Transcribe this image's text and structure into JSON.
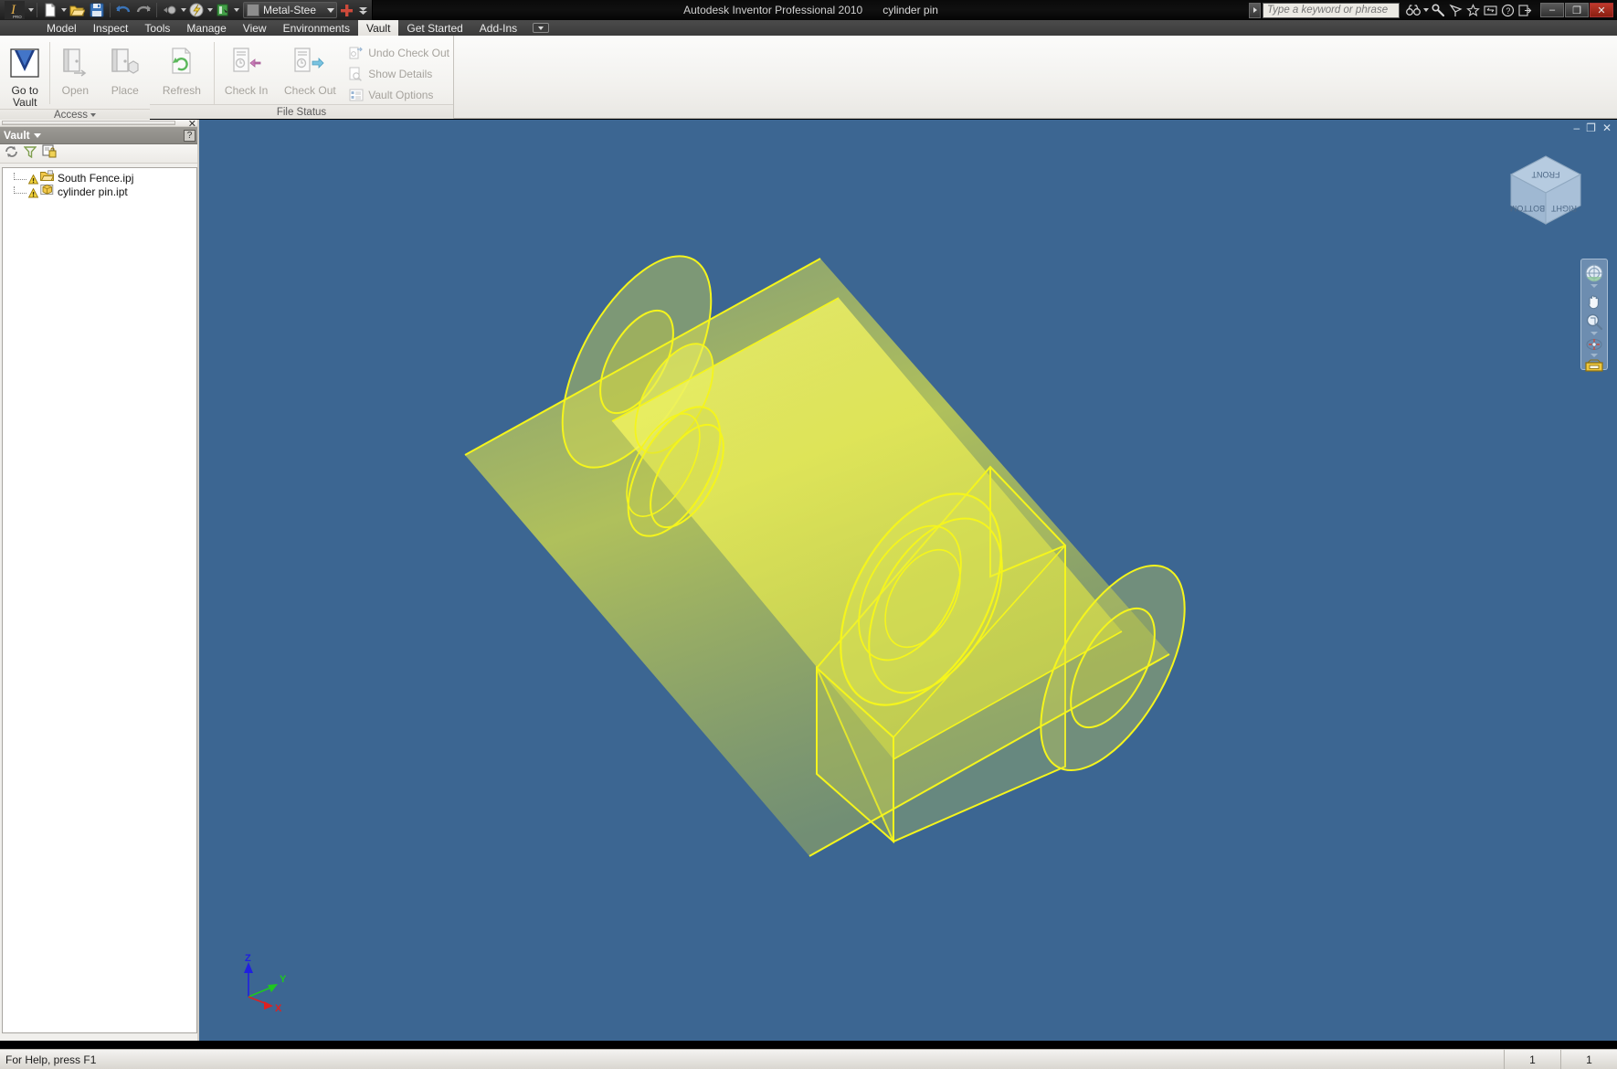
{
  "app": {
    "title": "Autodesk Inventor Professional 2010",
    "document_name": "cylinder pin"
  },
  "quick_access": {
    "new_label": "new-file",
    "open_label": "open-file",
    "save_label": "save-file",
    "undo_label": "undo",
    "redo_label": "redo",
    "material_value": "Metal-Stee",
    "plus_label": "+",
    "dropdown_label": "customize"
  },
  "search": {
    "placeholder": "Type a keyword or phrase",
    "icons": [
      "binoculars-icon",
      "wrench-icon",
      "satellite-icon",
      "star-icon",
      "exchange-icon",
      "help-icon",
      "signout-icon"
    ]
  },
  "window_controls": {
    "minimize": "–",
    "restore": "❐",
    "close": "✕"
  },
  "ribbon": {
    "tabs": [
      {
        "label": "Model",
        "active": false
      },
      {
        "label": "Inspect",
        "active": false
      },
      {
        "label": "Tools",
        "active": false
      },
      {
        "label": "Manage",
        "active": false
      },
      {
        "label": "View",
        "active": false
      },
      {
        "label": "Environments",
        "active": false
      },
      {
        "label": "Vault",
        "active": true
      },
      {
        "label": "Get Started",
        "active": false
      },
      {
        "label": "Add-Ins",
        "active": false
      }
    ],
    "panels": [
      {
        "title": "Access",
        "has_dropdown": true,
        "big_buttons": [
          {
            "label": "Go to Vault",
            "icon": "vault-icon",
            "disabled": false
          },
          {
            "label": "Open",
            "icon": "open-door-icon",
            "disabled": true
          },
          {
            "label": "Place",
            "icon": "place-door-icon",
            "disabled": true
          }
        ]
      },
      {
        "title": "File Status",
        "has_dropdown": false,
        "big_buttons": [
          {
            "label": "Refresh",
            "icon": "refresh-icon",
            "disabled": true
          },
          {
            "label": "Check In",
            "icon": "check-in-icon",
            "disabled": true
          },
          {
            "label": "Check Out",
            "icon": "check-out-icon",
            "disabled": true
          }
        ],
        "small_buttons": [
          {
            "label": "Undo Check Out",
            "icon": "undo-check-out-icon",
            "disabled": true
          },
          {
            "label": "Show Details",
            "icon": "show-details-icon",
            "disabled": true
          },
          {
            "label": "Vault Options",
            "icon": "vault-options-icon",
            "disabled": true
          }
        ]
      }
    ]
  },
  "browser": {
    "title": "Vault",
    "help_glyph": "?",
    "toolbar": [
      {
        "name": "refresh-icon",
        "tooltip": "Refresh"
      },
      {
        "name": "filter-icon",
        "tooltip": "Filter"
      },
      {
        "name": "add-lock-icon",
        "tooltip": "Check In"
      }
    ],
    "tree": [
      {
        "label": "South Fence.ipj",
        "icon": "project-folder-icon",
        "status": "warning-icon"
      },
      {
        "label": "cylinder pin.ipt",
        "icon": "part-file-icon",
        "status": "warning-icon"
      }
    ]
  },
  "viewport": {
    "background_color": "#3c6692",
    "model_color": "#f2f215",
    "model_name": "cylinder pin",
    "viewcube": {
      "faces": [
        "FRONT",
        "BOTTOM",
        "RIGHT"
      ]
    },
    "navigation_bar": [
      {
        "name": "steering-wheel-icon"
      },
      {
        "name": "pan-hand-icon"
      },
      {
        "name": "zoom-magnifier-icon"
      },
      {
        "name": "orbit-icon"
      },
      {
        "name": "look-at-icon"
      }
    ],
    "axis_indicator": {
      "x_label": "X",
      "x_color": "#e02020",
      "y_label": "Y",
      "y_color": "#1ec81e",
      "z_label": "Z",
      "z_color": "#2020e0"
    },
    "window_controls": {
      "minimize": "–",
      "restore": "❐",
      "close": "✕"
    }
  },
  "statusbar": {
    "message": "For Help, press F1",
    "cells": [
      "1",
      "1"
    ]
  }
}
